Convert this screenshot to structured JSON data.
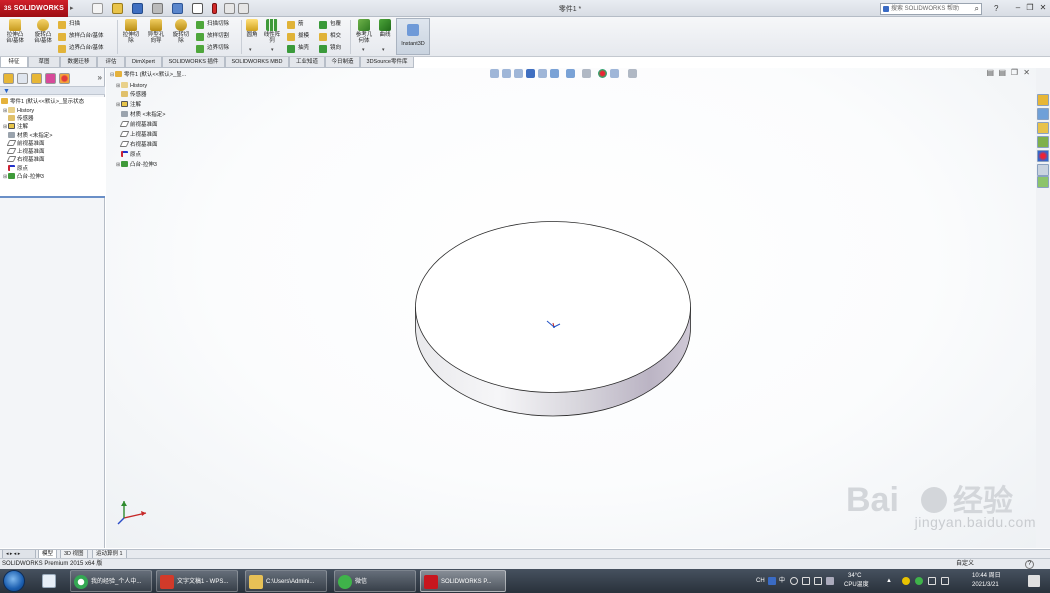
{
  "titlebar": {
    "logo_prefix": "3S",
    "logo_text": "SOLIDWORKS",
    "doc_title": "零件1 *",
    "help_search_placeholder": "搜索 SOLIDWORKS 帮助"
  },
  "command_manager": {
    "extrude_boss": "拉伸凸\n台/基体",
    "revolve_boss": "旋转凸\n台/基体",
    "sweep": "扫描",
    "loft": "放样凸台/基体",
    "boundary": "边界凸台/基体",
    "extrude_cut": "拉伸切\n除",
    "hole_wizard": "异型孔\n向导",
    "revolve_cut": "旋转切\n除",
    "swept_cut": "扫描切除",
    "lofted_cut": "放样切割",
    "boundary_cut": "边界切除",
    "fillet": "圆角",
    "linear_pattern": "线性阵\n列",
    "rib": "筋",
    "draft": "拔模",
    "shell": "抽壳",
    "wrap": "包覆",
    "intersect": "相交",
    "mirror": "镜向",
    "reference_geometry": "参考几\n何体",
    "curves": "曲线",
    "instant3d": "Instant3D"
  },
  "tabs": [
    "特征",
    "草图",
    "数据迁移",
    "评估",
    "DimXpert",
    "SOLIDWORKS 插件",
    "SOLIDWORKS MBD",
    "工业知道",
    "今日制造",
    "3DSource零件库"
  ],
  "left_tree": {
    "root": "零件1 (默认<<默认>_显示状态",
    "items": [
      "History",
      "传感器",
      "注解",
      "材质 <未指定>",
      "前视基准面",
      "上视基准面",
      "右视基准面",
      "原点",
      "凸台-拉伸3"
    ]
  },
  "viewport_tree": {
    "root": "零件1 (默认<<默认>_显...",
    "items": [
      "History",
      "传感器",
      "注解",
      "材质 <未指定>",
      "前视基准面",
      "上视基准面",
      "右视基准面",
      "原点",
      "凸台-拉伸3"
    ]
  },
  "model_tabs": [
    "模型",
    "3D 视图",
    "运动算例 1"
  ],
  "status": {
    "product": "SOLIDWORKS Premium 2015 x64 版",
    "units": "自定义",
    "help": "?"
  },
  "taskbar": {
    "apps": [
      "我的经验_个人中...",
      "文字文稿1 - WPS...",
      "C:\\Users\\Admini...",
      "微信",
      "SOLIDWORKS P..."
    ]
  },
  "tray": {
    "temp": "34°C",
    "cpu": "CPU温度",
    "time": "10:44 周日",
    "date": "2021/3/21",
    "ime": "中"
  },
  "watermark": {
    "logo_text": "Bai 经验",
    "url": "jingyan.baidu.com"
  },
  "colors": {
    "sw_red": "#c8161e",
    "accent_blue": "#2a63c5",
    "taskbar": "#2f3843"
  }
}
